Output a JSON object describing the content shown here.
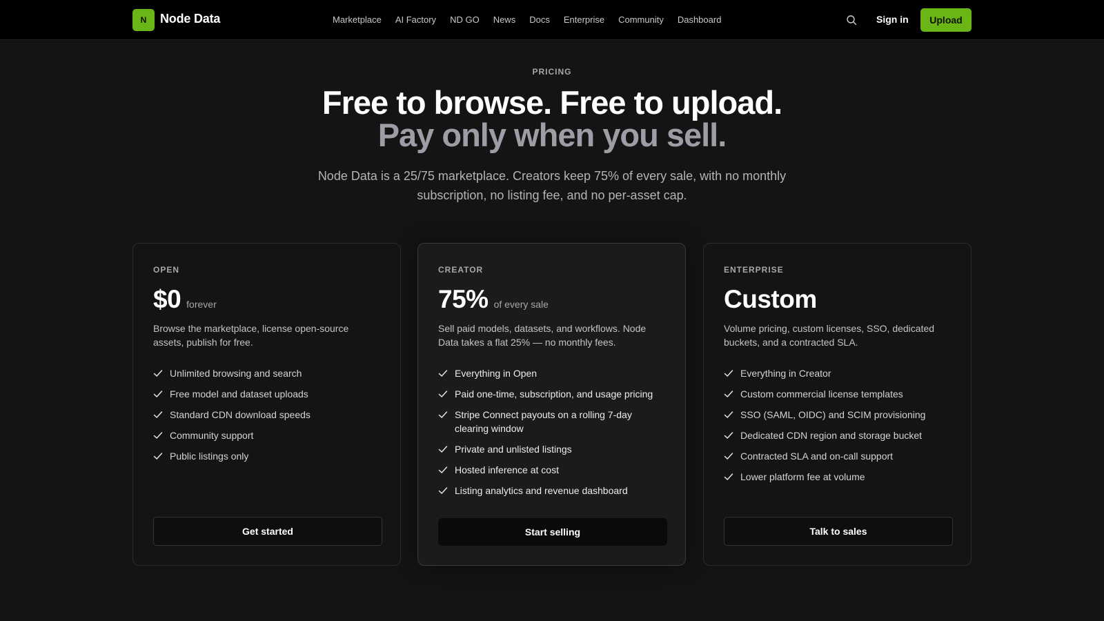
{
  "header": {
    "logo_mark": "N",
    "logo_text": "Node Data",
    "nav": [
      "Marketplace",
      "AI Factory",
      "ND GO",
      "News",
      "Docs",
      "Enterprise",
      "Community",
      "Dashboard"
    ],
    "search_icon": "search-icon",
    "signin_label": "Sign in",
    "upload_label": "Upload"
  },
  "hero": {
    "eyebrow": "PRICING",
    "title_line1": "Free to browse. Free to upload.",
    "title_line2": "Pay only when you sell.",
    "subtitle": "Node Data is a 25/75 marketplace. Creators keep 75% of every sale, with no monthly subscription, no listing fee, and no per-asset cap."
  },
  "plans": [
    {
      "tier": "OPEN",
      "price": "$0",
      "price_suffix": "forever",
      "description": "Browse the marketplace, license open-source assets, publish for free.",
      "features": [
        "Unlimited browsing and search",
        "Free model and dataset uploads",
        "Standard CDN download speeds",
        "Community support",
        "Public listings only"
      ],
      "cta": "Get started"
    },
    {
      "tier": "CREATOR",
      "price": "75%",
      "price_suffix": "of every sale",
      "description": "Sell paid models, datasets, and workflows. Node Data takes a flat 25% — no monthly fees.",
      "features": [
        "Everything in Open",
        "Paid one-time, subscription, and usage pricing",
        "Stripe Connect payouts on a rolling 7-day clearing window",
        "Private and unlisted listings",
        "Hosted inference at cost",
        "Listing analytics and revenue dashboard"
      ],
      "cta": "Start selling"
    },
    {
      "tier": "ENTERPRISE",
      "price": "Custom",
      "price_suffix": "",
      "description": "Volume pricing, custom licenses, SSO, dedicated buckets, and a contracted SLA.",
      "features": [
        "Everything in Creator",
        "Custom commercial license templates",
        "SSO (SAML, OIDC) and SCIM provisioning",
        "Dedicated CDN region and storage bucket",
        "Contracted SLA and on-call support",
        "Lower platform fee at volume"
      ],
      "cta": "Talk to sales"
    }
  ],
  "colors": {
    "accent": "#6ab617",
    "background": "#141414",
    "topbar": "#000000"
  }
}
